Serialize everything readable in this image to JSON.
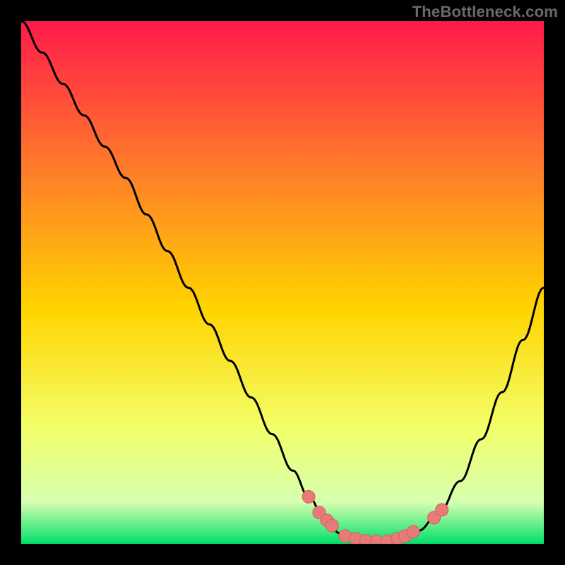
{
  "attribution": "TheBottleneck.com",
  "colors": {
    "gradient_top": "#ff1a4b",
    "gradient_upper_mid": "#ff7b2a",
    "gradient_mid": "#ffd400",
    "gradient_lower_mid": "#f3ff6a",
    "gradient_near_bottom": "#d7ffb0",
    "gradient_bottom": "#00e06a",
    "curve": "#000000",
    "marker_fill": "#e77b79",
    "marker_stroke": "#d9605e",
    "frame": "#000000"
  },
  "chart_data": {
    "type": "line",
    "title": "",
    "xlabel": "",
    "ylabel": "",
    "xlim": [
      0,
      100
    ],
    "ylim": [
      0,
      100
    ],
    "grid": false,
    "legend": false,
    "series": [
      {
        "name": "bottleneck-curve",
        "x": [
          0,
          4,
          8,
          12,
          16,
          20,
          24,
          28,
          32,
          36,
          40,
          44,
          48,
          52,
          55,
          58,
          61,
          64,
          67,
          70,
          73,
          76,
          80,
          84,
          88,
          92,
          96,
          100
        ],
        "y": [
          100,
          94,
          88,
          82,
          76,
          70,
          63,
          56,
          49,
          42,
          35,
          28,
          21,
          14,
          9,
          5,
          2,
          1,
          0.5,
          0.5,
          1,
          2.5,
          6,
          12,
          20,
          29,
          39,
          49
        ]
      }
    ],
    "markers": {
      "name": "highlighted-points",
      "x": [
        55,
        57,
        58.5,
        59.5,
        62,
        64,
        66,
        68,
        70,
        72,
        73.5,
        75,
        79,
        80.5
      ],
      "y": [
        9,
        6,
        4.5,
        3.5,
        1.5,
        1,
        0.6,
        0.5,
        0.5,
        1,
        1.5,
        2.3,
        5,
        6.5
      ]
    }
  }
}
